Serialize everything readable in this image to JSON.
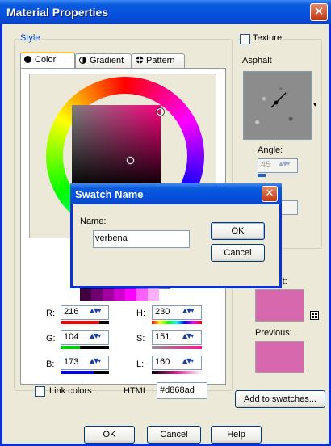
{
  "window": {
    "title": "Material Properties"
  },
  "style_group": {
    "label": "Style"
  },
  "tabs": [
    {
      "label": "Color",
      "icon": "filled-circle-icon"
    },
    {
      "label": "Gradient",
      "icon": "half-circle-icon"
    },
    {
      "label": "Pattern",
      "icon": "pattern-icon"
    }
  ],
  "color_wheel": {
    "hue_ring": "spectrum",
    "selected_hue_deg": 324
  },
  "rgb": {
    "r_label": "R:",
    "r": "216",
    "g_label": "G:",
    "g": "104",
    "b_label": "B:",
    "b": "173"
  },
  "hsl": {
    "h_label": "H:",
    "h": "230",
    "s_label": "S:",
    "s": "151",
    "l_label": "L:",
    "l": "160"
  },
  "link_colors": {
    "label": "Link colors",
    "checked": false
  },
  "html_field": {
    "label": "HTML:",
    "value": "#d868ad"
  },
  "texture": {
    "label": "Texture",
    "checked": false,
    "name": "Asphalt",
    "angle_label": "Angle:",
    "angle_value": "45",
    "scale_value": ""
  },
  "current": {
    "label": "Current:",
    "color": "#d868ad"
  },
  "previous": {
    "label": "Previous:",
    "color": "#d868ad"
  },
  "add_swatches": {
    "label": "Add to swatches..."
  },
  "footer": {
    "ok": "OK",
    "cancel": "Cancel",
    "help": "Help"
  },
  "swatch_dialog": {
    "title": "Swatch Name",
    "name_label": "Name:",
    "name_value": "verbena",
    "ok": "OK",
    "cancel": "Cancel"
  },
  "colors": {
    "accent": "#0451e0",
    "selected": "#d868ad"
  }
}
